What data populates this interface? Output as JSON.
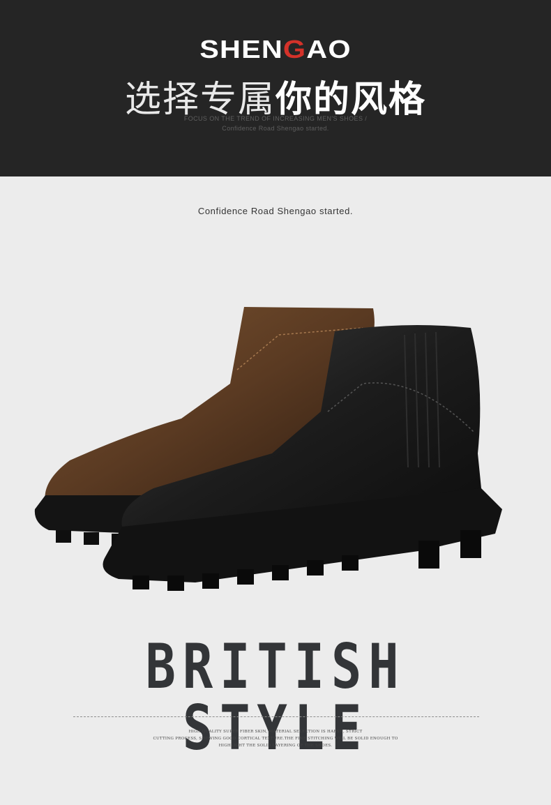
{
  "header": {
    "brand_prefix": "SHEN",
    "brand_accent": "G",
    "brand_suffix": "AO",
    "headline_thin": "选择专属",
    "headline_bold": "你的风格",
    "subline_1": "FOCUS ON THE TREND OF INCREASING MEN'S SHOES /",
    "subline_2": "Confidence Road Shengao started."
  },
  "section": {
    "tagline": "Confidence Road Shengao started."
  },
  "product": {
    "image_label": "two brogue chelsea boots, brown and black",
    "colors": [
      "#5a3a22",
      "#1c1c1c"
    ]
  },
  "style_block": {
    "title": "BRITISH STYLE",
    "desc_line_1": "high quality super fiber skin, material selection is harsh, strict",
    "desc_line_2": "cutting process, showing good cortical texture.the fine stitching will be solid enough to",
    "desc_line_3": "highlight the solid layering of the shoes."
  },
  "colors": {
    "dark_band": "#252525",
    "page_bg": "#ececec",
    "brand_accent": "#d4322a",
    "title_text": "#333538"
  }
}
